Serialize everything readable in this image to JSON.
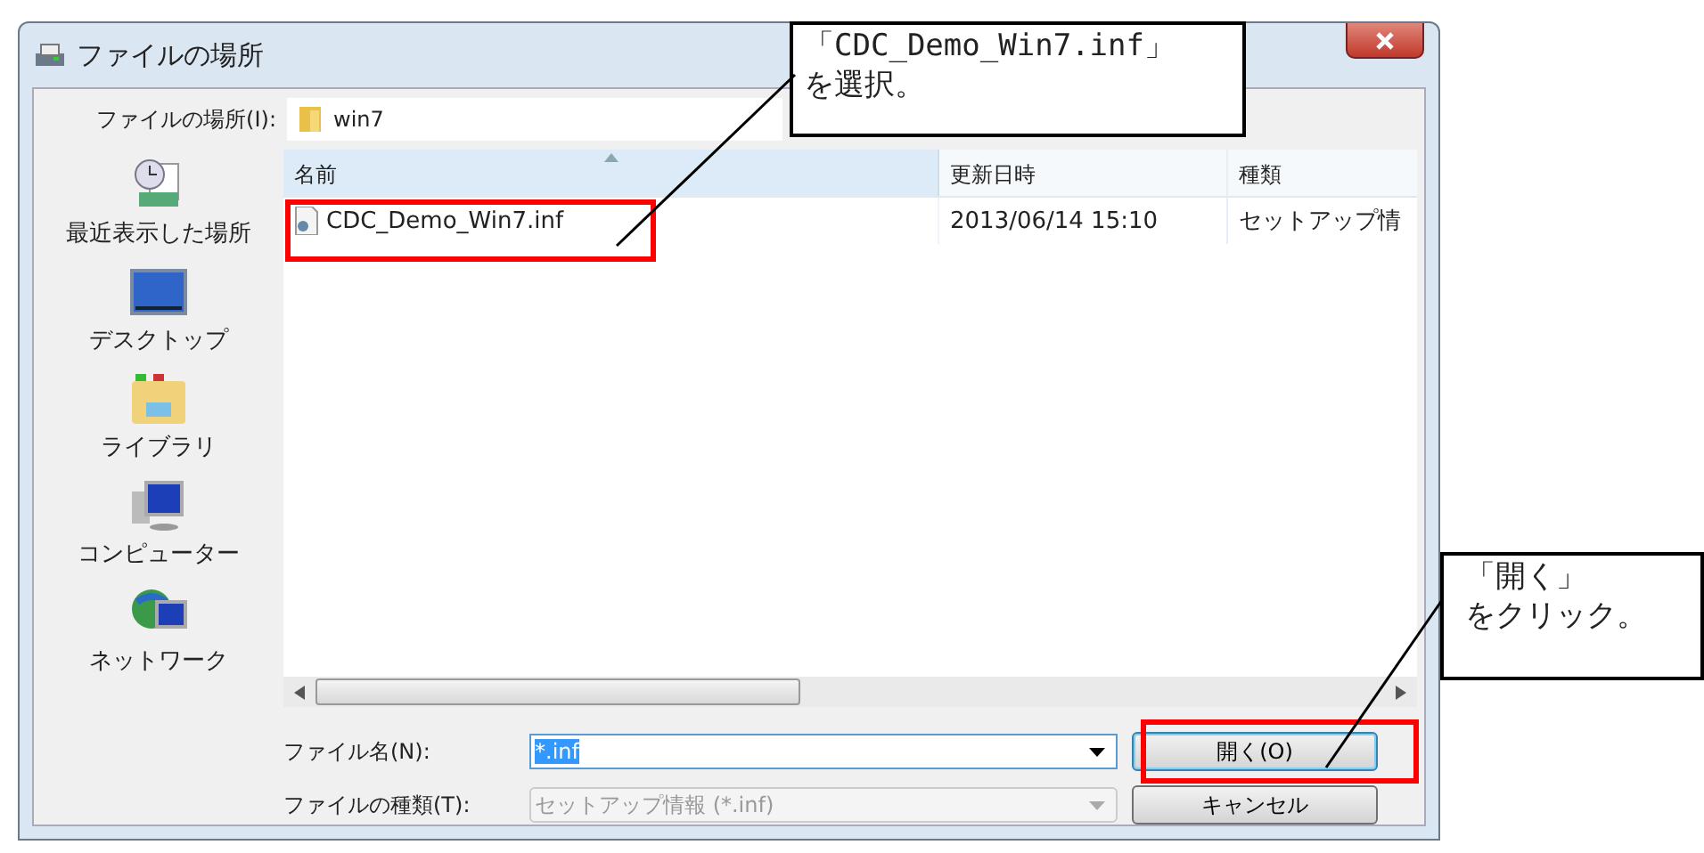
{
  "window": {
    "title": "ファイルの場所"
  },
  "location": {
    "label": "ファイルの場所(I):",
    "value": "win7"
  },
  "places": [
    {
      "label": "最近表示した場所",
      "kind": "recent"
    },
    {
      "label": "デスクトップ",
      "kind": "desktop"
    },
    {
      "label": "ライブラリ",
      "kind": "library"
    },
    {
      "label": "コンピューター",
      "kind": "computer"
    },
    {
      "label": "ネットワーク",
      "kind": "network"
    }
  ],
  "table": {
    "columns": [
      "名前",
      "更新日時",
      "種類"
    ],
    "rows": [
      {
        "name": "CDC_Demo_Win7.inf",
        "modified": "2013/06/14 15:10",
        "type": "セットアップ情"
      }
    ]
  },
  "file_name": {
    "label": "ファイル名(N):",
    "value": "*.inf"
  },
  "file_type": {
    "label": "ファイルの種類(T):",
    "value": "セットアップ情報 (*.inf)",
    "disabled": true
  },
  "buttons": [
    {
      "label": "開く(O)",
      "default": true
    },
    {
      "label": "キャンセル",
      "default": false
    }
  ],
  "callouts": [
    {
      "lines": [
        "「CDC_Demo_Win7.inf」",
        "を選択。"
      ]
    },
    {
      "lines": [
        "「開く」",
        "をクリック。"
      ]
    }
  ]
}
